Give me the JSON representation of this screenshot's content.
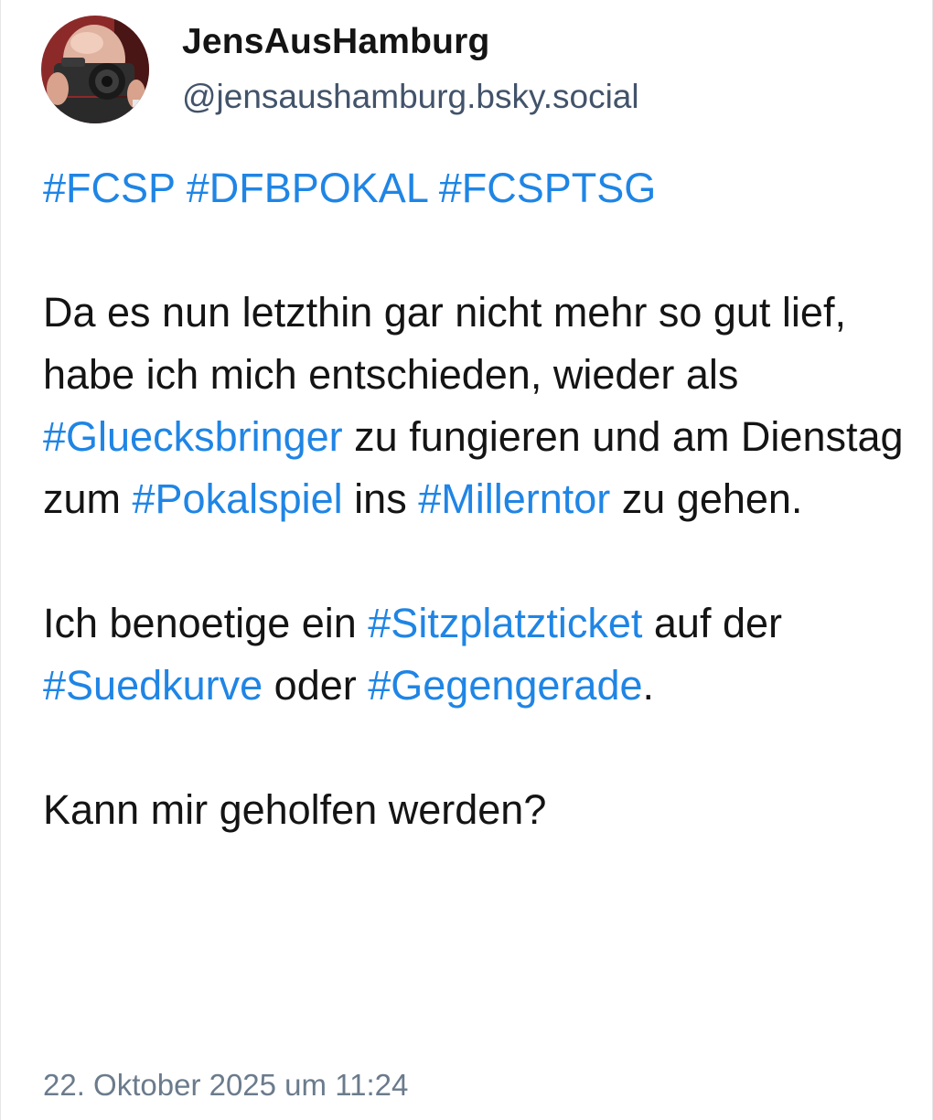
{
  "author": {
    "display_name": "JensAusHamburg",
    "handle": "@jensaushamburg.bsky.social",
    "avatar_icon": "avatar-photographer-with-camera"
  },
  "post": {
    "hashtag_line": [
      "#FCSP",
      " ",
      "#DFBPOKAL",
      " ",
      "#FCSPTSG"
    ],
    "para1": {
      "t1": "Da es nun letzthin gar nicht mehr so gut lief, habe ich mich entschieden, wieder als ",
      "h1": "#Gluecksbringer",
      "t2": " zu fungieren und am Dienstag zum ",
      "h2": "#Pokalspiel",
      "t3": " ins ",
      "h3": "#Millerntor",
      "t4": " zu gehen."
    },
    "para2": {
      "t1": "Ich benoetige ein ",
      "h1": "#Sitzplatzticket",
      "t2": " auf der ",
      "h2": "#Suedkurve",
      "t3": " oder ",
      "h3": "#Gegengerade",
      "t4": "."
    },
    "para3": "Kann mir geholfen werden?",
    "timestamp": "22. Oktober 2025 um 11:24"
  },
  "colors": {
    "hashtag": "#1f85e5",
    "text": "#141414",
    "handle": "#42536a",
    "timestamp": "#6b7b8c"
  }
}
